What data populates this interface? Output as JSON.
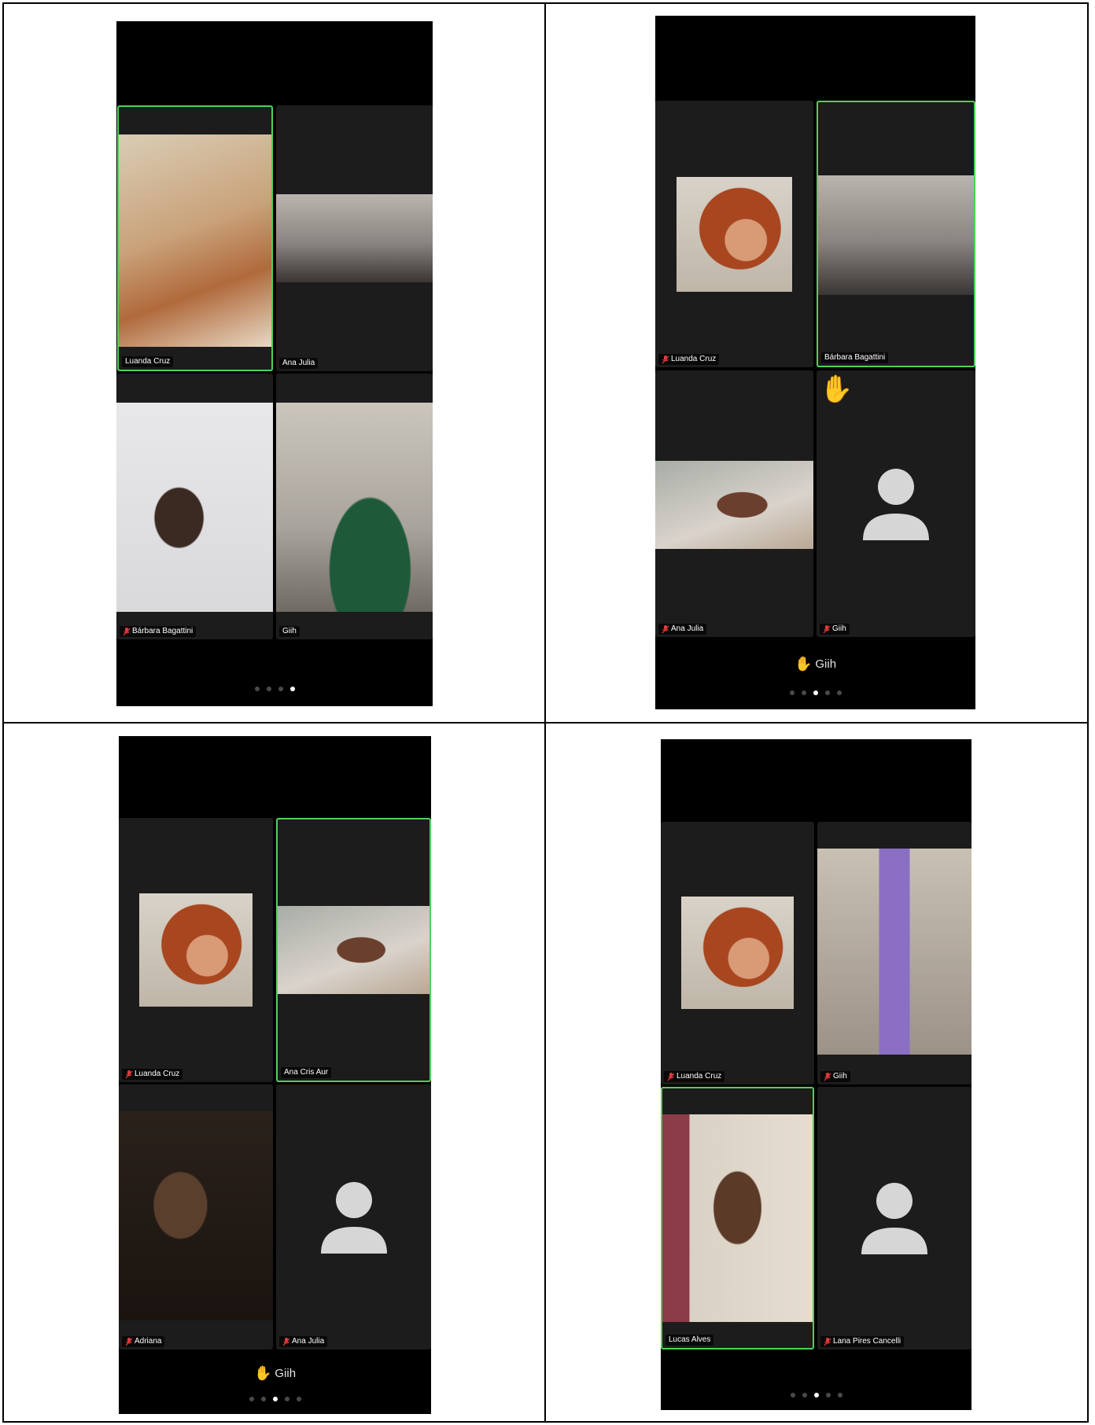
{
  "panels": [
    {
      "tiles": [
        {
          "name": "Luanda Cruz",
          "muted": false,
          "active": true
        },
        {
          "name": "Ana Julia",
          "muted": false,
          "active": false
        },
        {
          "name": "Bárbara Bagattini",
          "muted": true,
          "active": false
        },
        {
          "name": "Giih",
          "muted": false,
          "active": false
        }
      ],
      "raised_hand_name": "",
      "page_dots": 4,
      "active_dot": 4
    },
    {
      "tiles": [
        {
          "name": "Luanda Cruz",
          "muted": true,
          "active": false
        },
        {
          "name": "Bárbara Bagattini",
          "muted": false,
          "active": true
        },
        {
          "name": "Ana Julia",
          "muted": true,
          "active": false
        },
        {
          "name": "Giih",
          "muted": true,
          "active": false,
          "avatar": true,
          "raised_hand": true
        }
      ],
      "raised_hand_name": "Giih",
      "page_dots": 5,
      "active_dot": 3
    },
    {
      "tiles": [
        {
          "name": "Luanda Cruz",
          "muted": true,
          "active": false
        },
        {
          "name": "Ana Cris Aur",
          "muted": false,
          "active": true
        },
        {
          "name": "Adriana",
          "muted": true,
          "active": false
        },
        {
          "name": "Ana Julia",
          "muted": true,
          "active": false,
          "avatar": true
        }
      ],
      "raised_hand_name": "Giih",
      "page_dots": 5,
      "active_dot": 3
    },
    {
      "tiles": [
        {
          "name": "Luanda Cruz",
          "muted": true,
          "active": false
        },
        {
          "name": "Giih",
          "muted": true,
          "active": false
        },
        {
          "name": "Lucas Alves",
          "muted": false,
          "active": true
        },
        {
          "name": "Lana Pires Cancelli",
          "muted": true,
          "active": false,
          "avatar": true
        }
      ],
      "raised_hand_name": "",
      "page_dots": 5,
      "active_dot": 3
    }
  ]
}
